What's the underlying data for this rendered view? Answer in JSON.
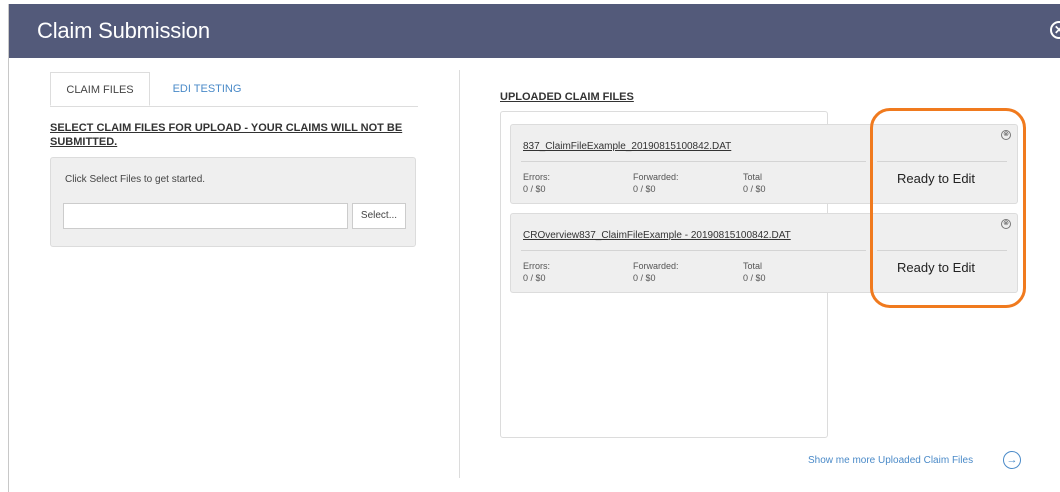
{
  "header": {
    "title": "Claim Submission",
    "close_icon": "close-circle-icon"
  },
  "tabs": [
    {
      "label": "CLAIM FILES",
      "active": true
    },
    {
      "label": "EDI TESTING",
      "active": false
    }
  ],
  "upload": {
    "heading": "SELECT CLAIM FILES FOR UPLOAD - YOUR CLAIMS WILL NOT BE SUBMITTED.",
    "hint": "Click Select Files to get started.",
    "file_value": "",
    "select_label": "Select..."
  },
  "uploaded": {
    "heading": "UPLOADED CLAIM FILES",
    "files": [
      {
        "name": "837_ClaimFileExample_20190815100842.DAT",
        "errors_label": "Errors:",
        "errors_value": "0 / $0",
        "forwarded_label": "Forwarded:",
        "forwarded_value": "0 / $0",
        "total_label": "Total",
        "total_value": "0 / $0",
        "status": "Ready to Edit"
      },
      {
        "name": "CROverview837_ClaimFileExample - 20190815100842.DAT",
        "errors_label": "Errors:",
        "errors_value": "0 / $0",
        "forwarded_label": "Forwarded:",
        "forwarded_value": "0 / $0",
        "total_label": "Total",
        "total_value": "0 / $0",
        "status": "Ready to Edit"
      }
    ],
    "show_more_label": "Show me more Uploaded Claim Files",
    "remove_glyph": "⊗",
    "show_more_glyph": "→"
  },
  "colors": {
    "header": "#535a7a",
    "accent": "#4a8ac8",
    "highlight": "#f07a1e"
  },
  "close_glyph": "✕"
}
